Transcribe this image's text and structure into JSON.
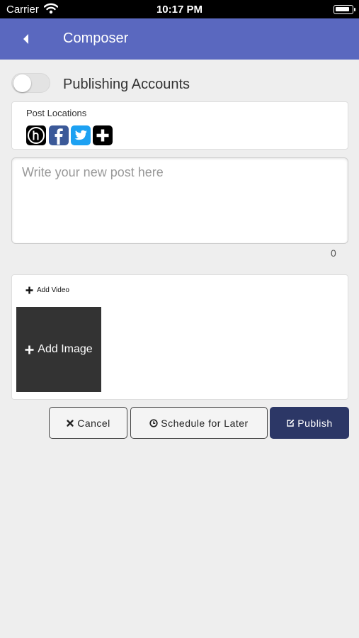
{
  "status_bar": {
    "carrier": "Carrier",
    "time": "10:17 PM"
  },
  "nav": {
    "title": "Composer"
  },
  "publishing": {
    "label": "Publishing Accounts",
    "enabled": false
  },
  "locations": {
    "title": "Post Locations",
    "icons": [
      "h-logo-icon",
      "facebook-icon",
      "twitter-icon",
      "add-location-icon"
    ]
  },
  "post": {
    "placeholder": "Write your new post here",
    "value": "",
    "char_count": "0"
  },
  "media": {
    "add_video": "Add Video",
    "add_image": "Add Image"
  },
  "actions": {
    "cancel": "Cancel",
    "schedule": "Schedule for Later",
    "publish": "Publish"
  },
  "colors": {
    "nav": "#5a68bf",
    "publish": "#2c3766",
    "facebook": "#3b5998",
    "twitter": "#1da1f2"
  }
}
